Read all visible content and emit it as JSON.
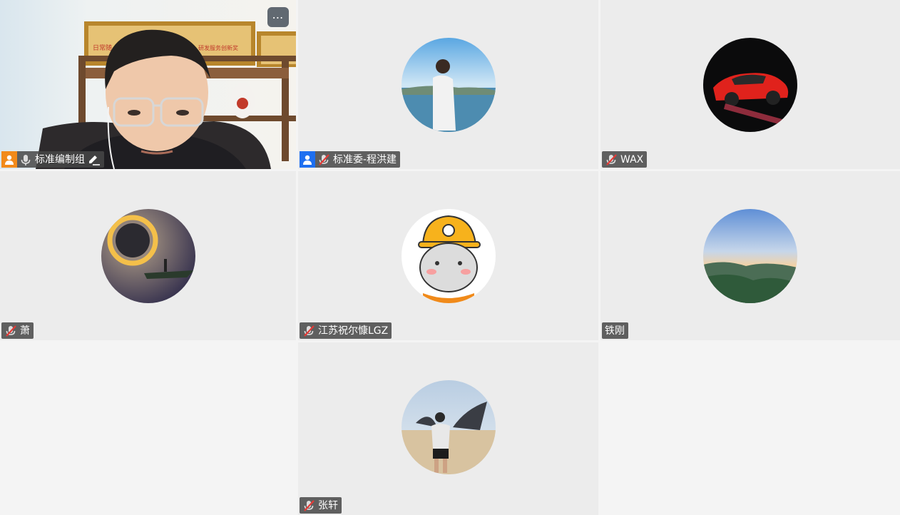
{
  "participants": [
    {
      "name": "标准编制组",
      "role": "host",
      "mic": "on",
      "video": true,
      "editing": true
    },
    {
      "name": "标准委-程洪建",
      "role": "cohost",
      "mic": "muted"
    },
    {
      "name": "WAX",
      "mic": "muted"
    },
    {
      "name": "萧",
      "mic": "muted"
    },
    {
      "name": "江苏祝尔慷LGZ",
      "mic": "muted"
    },
    {
      "name": "铁刚",
      "mic": "none"
    },
    {
      "name": "张轩",
      "mic": "muted"
    }
  ],
  "controls": {
    "more_label": "⋯"
  },
  "video_scene": {
    "banner_left": "日常随",
    "banner_right": "研发服务创新奖"
  },
  "colors": {
    "host_badge": "#f28a1a",
    "cohost_badge": "#1e6ff0",
    "tile_bg": "#ececec",
    "empty_bg": "#f4f4f4"
  }
}
